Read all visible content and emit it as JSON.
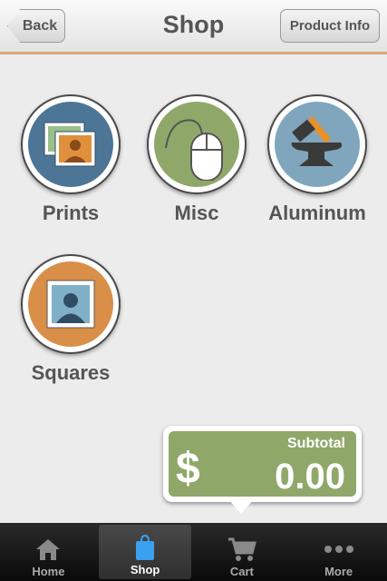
{
  "header": {
    "title": "Shop",
    "back_label": "Back",
    "product_info_label": "Product Info"
  },
  "categories": [
    {
      "label": "Prints",
      "icon": "prints-icon",
      "color": "#4d7595"
    },
    {
      "label": "Misc",
      "icon": "mouse-icon",
      "color": "#8fa86a"
    },
    {
      "label": "Aluminum",
      "icon": "anvil-icon",
      "color": "#7fa6bd"
    },
    {
      "label": "Squares",
      "icon": "squares-icon",
      "color": "#d98f48"
    }
  ],
  "subtotal": {
    "label": "Subtotal",
    "currency": "$",
    "amount": "0.00"
  },
  "tabs": [
    {
      "label": "Home",
      "icon": "home-icon",
      "active": false
    },
    {
      "label": "Shop",
      "icon": "shopping-bag-icon",
      "active": true
    },
    {
      "label": "Cart",
      "icon": "cart-icon",
      "active": false
    },
    {
      "label": "More",
      "icon": "more-icon",
      "active": false
    }
  ],
  "colors": {
    "header_accent": "#d9a878",
    "subtotal_green": "#8fa86a",
    "tab_active": "#3aa0f0"
  }
}
